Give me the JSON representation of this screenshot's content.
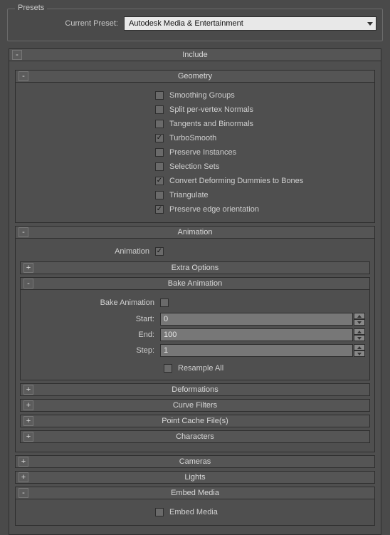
{
  "presets": {
    "legend": "Presets",
    "current_label": "Current Preset:",
    "current_value": "Autodesk Media & Entertainment"
  },
  "include": {
    "title": "Include",
    "toggle": "-",
    "geometry": {
      "title": "Geometry",
      "toggle": "-",
      "items": [
        {
          "label": "Smoothing Groups",
          "checked": false
        },
        {
          "label": "Split per-vertex Normals",
          "checked": false
        },
        {
          "label": "Tangents and Binormals",
          "checked": false
        },
        {
          "label": "TurboSmooth",
          "checked": true
        },
        {
          "label": "Preserve Instances",
          "checked": false
        },
        {
          "label": "Selection Sets",
          "checked": false
        },
        {
          "label": "Convert Deforming Dummies to Bones",
          "checked": true
        },
        {
          "label": "Triangulate",
          "checked": false
        },
        {
          "label": "Preserve edge orientation",
          "checked": true
        }
      ]
    },
    "animation": {
      "title": "Animation",
      "toggle": "-",
      "anim_label": "Animation",
      "anim_checked": true,
      "extra": {
        "title": "Extra Options",
        "toggle": "+"
      },
      "bake": {
        "title": "Bake Animation",
        "toggle": "-",
        "bake_label": "Bake Animation",
        "bake_checked": false,
        "start_label": "Start:",
        "start_value": "0",
        "end_label": "End:",
        "end_value": "100",
        "step_label": "Step:",
        "step_value": "1",
        "resample_label": "Resample All",
        "resample_checked": false
      },
      "deformations": {
        "title": "Deformations",
        "toggle": "+"
      },
      "curve_filters": {
        "title": "Curve Filters",
        "toggle": "+"
      },
      "point_cache": {
        "title": "Point Cache File(s)",
        "toggle": "+"
      },
      "characters": {
        "title": "Characters",
        "toggle": "+"
      }
    },
    "cameras": {
      "title": "Cameras",
      "toggle": "+"
    },
    "lights": {
      "title": "Lights",
      "toggle": "+"
    },
    "embed": {
      "title": "Embed Media",
      "toggle": "-",
      "cb_label": "Embed Media",
      "cb_checked": false
    }
  }
}
